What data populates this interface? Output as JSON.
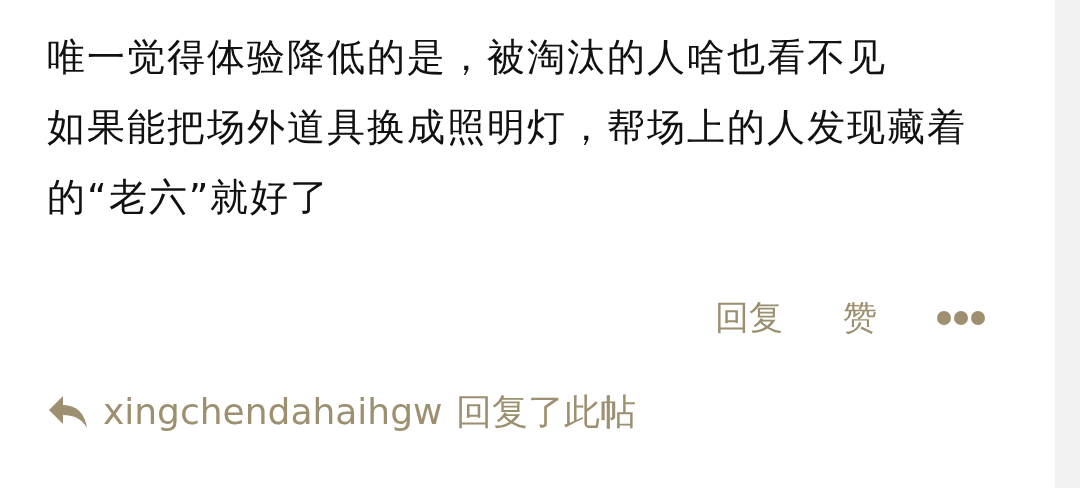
{
  "comment": {
    "paragraphs": [
      "唯一觉得体验降低的是，被淘汰的人啥也看不见",
      "如果能把场外道具换成照明灯，帮场上的人发现藏着的“老六”就好了"
    ]
  },
  "actions": [
    {
      "kind": "text",
      "label": "回复"
    },
    {
      "kind": "text",
      "label": "赞"
    },
    {
      "kind": "more"
    }
  ],
  "activity": {
    "user": "xingchendahaihgw",
    "text": "回复了此帖"
  }
}
